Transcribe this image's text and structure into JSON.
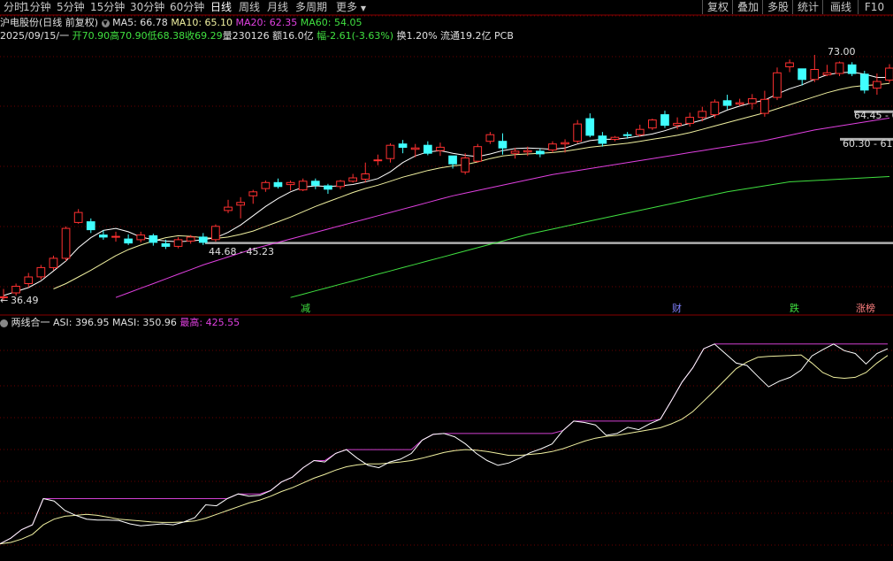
{
  "tabs": [
    {
      "label": "分时"
    },
    {
      "label": "1分钟"
    },
    {
      "label": "5分钟"
    },
    {
      "label": "15分钟"
    },
    {
      "label": "30分钟"
    },
    {
      "label": "60分钟"
    },
    {
      "label": "日线"
    },
    {
      "label": "周线"
    },
    {
      "label": "月线"
    },
    {
      "label": "多周期"
    },
    {
      "label": "更多"
    }
  ],
  "right_buttons": [
    {
      "label": "复权"
    },
    {
      "label": "叠加"
    },
    {
      "label": "多股"
    },
    {
      "label": "统计"
    },
    {
      "label": "画线"
    },
    {
      "label": "F10"
    }
  ],
  "ma_line": {
    "stock": "沪电股份(日线 前复权)",
    "ma5": "MA5: 66.78",
    "ma10": "MA10: 65.10",
    "ma20": "MA20: 62.35",
    "ma60": "MA60: 54.05"
  },
  "info_line": {
    "date": "2025/09/15/一",
    "open": "开70.90",
    "high": "高70.90",
    "low": "低68.38",
    "close": "收69.29",
    "volume": "量230126",
    "amount": "额16.0亿",
    "change": "幅-2.61(-3.63%)",
    "turnover": "换1.20%",
    "float": "流通19.2亿",
    "sector": "PCB"
  },
  "price_labels": {
    "high": "73.00",
    "range_upper": "64.45 - 6",
    "range_lower": "60.30 - 61.",
    "support": "44.68 - 45.23",
    "low": "36.49"
  },
  "event_markers": [
    {
      "label": "减"
    },
    {
      "label": "财"
    },
    {
      "label": "跌"
    },
    {
      "label": "涨榜"
    }
  ],
  "indicator": {
    "name": "两线合一",
    "asi": "ASI: 396.95",
    "masi": "MASI: 350.96",
    "highest": "最高: 425.55"
  },
  "colors": {
    "up": "#ff3030",
    "down": "#40ffff",
    "ma5": "#ffffff",
    "ma10": "#f0f0a0",
    "ma20": "#e040e0",
    "ma60": "#40e040",
    "grid": "#6a0000"
  },
  "chart_data": {
    "type": "candlestick",
    "ylim": [
      36,
      73
    ],
    "candles": [
      [
        36.5,
        36.6,
        36.0,
        37.8
      ],
      [
        37.2,
        38.2,
        36.8,
        38.6
      ],
      [
        38.6,
        39.6,
        38.0,
        40.2
      ],
      [
        39.6,
        41.0,
        39.2,
        41.4
      ],
      [
        41.0,
        42.4,
        40.6,
        42.8
      ],
      [
        42.4,
        46.9,
        42.0,
        47.2
      ],
      [
        47.8,
        49.3,
        47.6,
        49.8
      ],
      [
        47.9,
        46.7,
        46.2,
        48.4
      ],
      [
        45.9,
        45.6,
        45.2,
        46.6
      ],
      [
        45.6,
        45.7,
        44.9,
        46.4
      ],
      [
        45.3,
        44.7,
        44.4,
        46.0
      ],
      [
        45.2,
        45.9,
        44.8,
        46.4
      ],
      [
        45.8,
        44.8,
        44.3,
        46.1
      ],
      [
        44.6,
        44.2,
        43.8,
        45.2
      ],
      [
        44.2,
        45.2,
        43.9,
        45.6
      ],
      [
        45.0,
        45.6,
        44.6,
        45.9
      ],
      [
        45.6,
        44.8,
        44.4,
        46.2
      ],
      [
        45.2,
        47.2,
        44.9,
        47.5
      ],
      [
        49.6,
        50.1,
        49.2,
        51.2
      ],
      [
        50.4,
        50.8,
        48.4,
        51.6
      ],
      [
        51.8,
        52.4,
        50.6,
        52.7
      ],
      [
        52.9,
        53.8,
        52.4,
        54.1
      ],
      [
        53.8,
        53.2,
        52.9,
        54.4
      ],
      [
        53.5,
        53.8,
        52.6,
        54.1
      ],
      [
        52.7,
        54.0,
        52.5,
        54.4
      ],
      [
        54.0,
        53.4,
        52.8,
        54.4
      ],
      [
        53.3,
        52.8,
        52.1,
        53.6
      ],
      [
        53.2,
        54.0,
        52.8,
        54.2
      ],
      [
        54.0,
        54.5,
        53.8,
        55.1
      ],
      [
        54.3,
        55.1,
        53.8,
        56.8
      ],
      [
        57.2,
        57.2,
        56.4,
        58.0
      ],
      [
        57.4,
        59.4,
        56.8,
        59.7
      ],
      [
        59.6,
        59.1,
        58.2,
        60.2
      ],
      [
        58.8,
        59.0,
        57.6,
        59.6
      ],
      [
        59.4,
        58.2,
        57.9,
        60.0
      ],
      [
        58.6,
        59.1,
        57.8,
        59.8
      ],
      [
        57.8,
        56.6,
        55.9,
        57.8
      ],
      [
        55.4,
        57.5,
        55.0,
        58.2
      ],
      [
        57.0,
        59.2,
        56.8,
        59.6
      ],
      [
        60.0,
        61.0,
        59.6,
        61.4
      ],
      [
        60.0,
        59.0,
        58.0,
        61.2
      ],
      [
        58.2,
        58.5,
        57.4,
        59.0
      ],
      [
        58.4,
        58.6,
        57.8,
        59.2
      ],
      [
        58.5,
        58.1,
        57.6,
        58.9
      ],
      [
        58.7,
        59.6,
        58.3,
        60.0
      ],
      [
        59.6,
        59.8,
        58.3,
        60.3
      ],
      [
        60.0,
        62.6,
        59.7,
        63.2
      ],
      [
        63.4,
        60.9,
        60.6,
        64.2
      ],
      [
        60.8,
        59.7,
        59.2,
        61.4
      ],
      [
        60.3,
        60.6,
        60.0,
        60.8
      ],
      [
        61.0,
        60.9,
        60.4,
        61.4
      ],
      [
        61.0,
        61.8,
        60.7,
        62.5
      ],
      [
        62.0,
        63.2,
        61.7,
        63.4
      ],
      [
        64.0,
        62.4,
        62.0,
        64.6
      ],
      [
        62.4,
        62.7,
        61.8,
        63.6
      ],
      [
        62.7,
        63.6,
        62.2,
        64.3
      ],
      [
        63.6,
        64.5,
        63.0,
        65.2
      ],
      [
        64.0,
        65.9,
        63.5,
        66.3
      ],
      [
        66.1,
        65.4,
        64.8,
        67.0
      ],
      [
        65.6,
        65.8,
        65.3,
        66.4
      ],
      [
        65.7,
        66.4,
        64.8,
        67.1
      ],
      [
        64.2,
        66.3,
        63.7,
        67.6
      ],
      [
        66.6,
        70.3,
        66.2,
        71.1
      ],
      [
        71.2,
        71.8,
        70.4,
        72.3
      ],
      [
        70.9,
        69.3,
        68.4,
        70.9
      ],
      [
        69.3,
        70.8,
        68.9,
        73.0
      ],
      [
        70.0,
        70.3,
        69.8,
        71.5
      ],
      [
        70.2,
        71.8,
        69.8,
        72.0
      ],
      [
        71.5,
        70.2,
        69.8,
        71.9
      ],
      [
        70.1,
        67.7,
        67.2,
        70.6
      ],
      [
        68.0,
        69.0,
        67.0,
        70.2
      ],
      [
        69.2,
        71.0,
        68.8,
        71.6
      ]
    ],
    "ma5": [
      36.8,
      37.4,
      38.0,
      39.0,
      40.5,
      42.0,
      44.0,
      45.5,
      46.6,
      46.9,
      46.4,
      45.6,
      45.2,
      45.0,
      44.9,
      45.0,
      45.2,
      45.5,
      46.3,
      47.4,
      48.8,
      50.2,
      51.4,
      52.4,
      53.1,
      53.3,
      53.2,
      53.3,
      53.5,
      53.9,
      54.4,
      55.4,
      56.8,
      57.8,
      58.4,
      58.6,
      58.2,
      57.9,
      57.7,
      58.1,
      58.6,
      58.9,
      59.0,
      58.9,
      58.8,
      59.0,
      59.6,
      60.1,
      60.3,
      60.3,
      60.5,
      60.8,
      61.1,
      61.6,
      62.2,
      62.7,
      63.2,
      63.9,
      64.7,
      65.3,
      65.8,
      66.2,
      67.1,
      67.9,
      68.5,
      69.3,
      70.0,
      70.3,
      70.4,
      70.1,
      69.6,
      69.6
    ],
    "ma10": [
      null,
      null,
      null,
      null,
      37.8,
      38.6,
      39.6,
      40.6,
      41.7,
      42.8,
      43.7,
      44.4,
      45.0,
      45.5,
      45.8,
      45.7,
      45.5,
      45.4,
      45.6,
      46.0,
      46.5,
      47.2,
      47.9,
      48.6,
      49.4,
      50.2,
      50.9,
      51.6,
      52.3,
      52.9,
      53.4,
      54.0,
      54.6,
      55.1,
      55.6,
      56.0,
      56.3,
      56.5,
      56.9,
      57.4,
      57.8,
      58.0,
      58.1,
      58.2,
      58.3,
      58.5,
      58.8,
      59.1,
      59.3,
      59.5,
      59.7,
      60.0,
      60.3,
      60.6,
      60.9,
      61.3,
      61.8,
      62.3,
      62.8,
      63.3,
      63.8,
      64.3,
      64.9,
      65.5,
      66.1,
      66.7,
      67.3,
      67.8,
      68.2,
      68.4,
      68.5,
      68.7
    ],
    "ma20": [
      null,
      null,
      null,
      null,
      null,
      null,
      null,
      null,
      null,
      36.5,
      37.2,
      37.9,
      38.6,
      39.3,
      40.0,
      40.7,
      41.4,
      42.0,
      42.6,
      43.2,
      43.8,
      44.3,
      44.8,
      45.3,
      45.8,
      46.3,
      46.8,
      47.3,
      47.8,
      48.3,
      48.8,
      49.3,
      49.8,
      50.3,
      50.8,
      51.3,
      51.8,
      52.2,
      52.6,
      53.0,
      53.4,
      53.8,
      54.2,
      54.6,
      55.0,
      55.3,
      55.6,
      55.9,
      56.2,
      56.5,
      56.8,
      57.1,
      57.4,
      57.7,
      58.0,
      58.3,
      58.6,
      58.9,
      59.2,
      59.5,
      59.8,
      60.1,
      60.5,
      60.9,
      61.3,
      61.7,
      62.0,
      62.3,
      62.6,
      62.9,
      63.2,
      63.5
    ],
    "ma60": [
      null,
      null,
      null,
      null,
      null,
      null,
      null,
      null,
      null,
      null,
      null,
      null,
      null,
      null,
      null,
      null,
      null,
      null,
      null,
      null,
      null,
      null,
      null,
      36.5,
      37.0,
      37.5,
      38.0,
      38.5,
      39.0,
      39.5,
      40.0,
      40.5,
      41.0,
      41.5,
      42.0,
      42.5,
      43.0,
      43.5,
      44.0,
      44.5,
      45.0,
      45.5,
      46.0,
      46.4,
      46.8,
      47.2,
      47.6,
      48.0,
      48.4,
      48.8,
      49.2,
      49.6,
      50.0,
      50.4,
      50.8,
      51.2,
      51.6,
      52.0,
      52.4,
      52.7,
      53.0,
      53.3,
      53.6,
      53.9,
      54.0,
      54.1,
      54.2,
      54.3,
      54.4,
      54.5,
      54.6,
      54.7
    ],
    "support_line": 44.7,
    "range_upper_line": 64.45,
    "range_lower_line": 60.3
  },
  "indicator_data": {
    "ylim": [
      -10,
      440
    ],
    "asi": [
      0,
      12,
      30,
      40,
      95,
      90,
      70,
      60,
      52,
      50,
      50,
      49,
      42,
      38,
      40,
      42,
      40,
      46,
      55,
      82,
      80,
      95,
      105,
      100,
      102,
      112,
      130,
      140,
      160,
      175,
      172,
      190,
      198,
      180,
      165,
      160,
      172,
      178,
      190,
      218,
      230,
      232,
      225,
      210,
      190,
      175,
      165,
      170,
      180,
      192,
      200,
      210,
      238,
      258,
      255,
      250,
      228,
      232,
      245,
      240,
      252,
      262,
      300,
      340,
      370,
      410,
      420,
      400,
      380,
      375,
      352,
      330,
      342,
      350,
      365,
      395,
      408,
      420,
      406,
      400,
      378,
      400,
      410
    ],
    "masi": [
      0,
      3,
      10,
      20,
      40,
      52,
      58,
      60,
      62,
      60,
      56,
      52,
      50,
      48,
      46,
      45,
      45,
      46,
      48,
      54,
      62,
      70,
      78,
      86,
      92,
      100,
      110,
      118,
      128,
      138,
      146,
      155,
      162,
      166,
      168,
      168,
      170,
      172,
      175,
      180,
      186,
      192,
      196,
      198,
      197,
      194,
      190,
      186,
      186,
      188,
      190,
      194,
      200,
      208,
      216,
      222,
      226,
      228,
      232,
      236,
      240,
      244,
      252,
      262,
      278,
      300,
      322,
      345,
      368,
      382,
      392,
      394,
      395,
      396,
      397,
      380,
      360,
      350,
      348,
      350,
      360,
      380,
      396
    ]
  }
}
